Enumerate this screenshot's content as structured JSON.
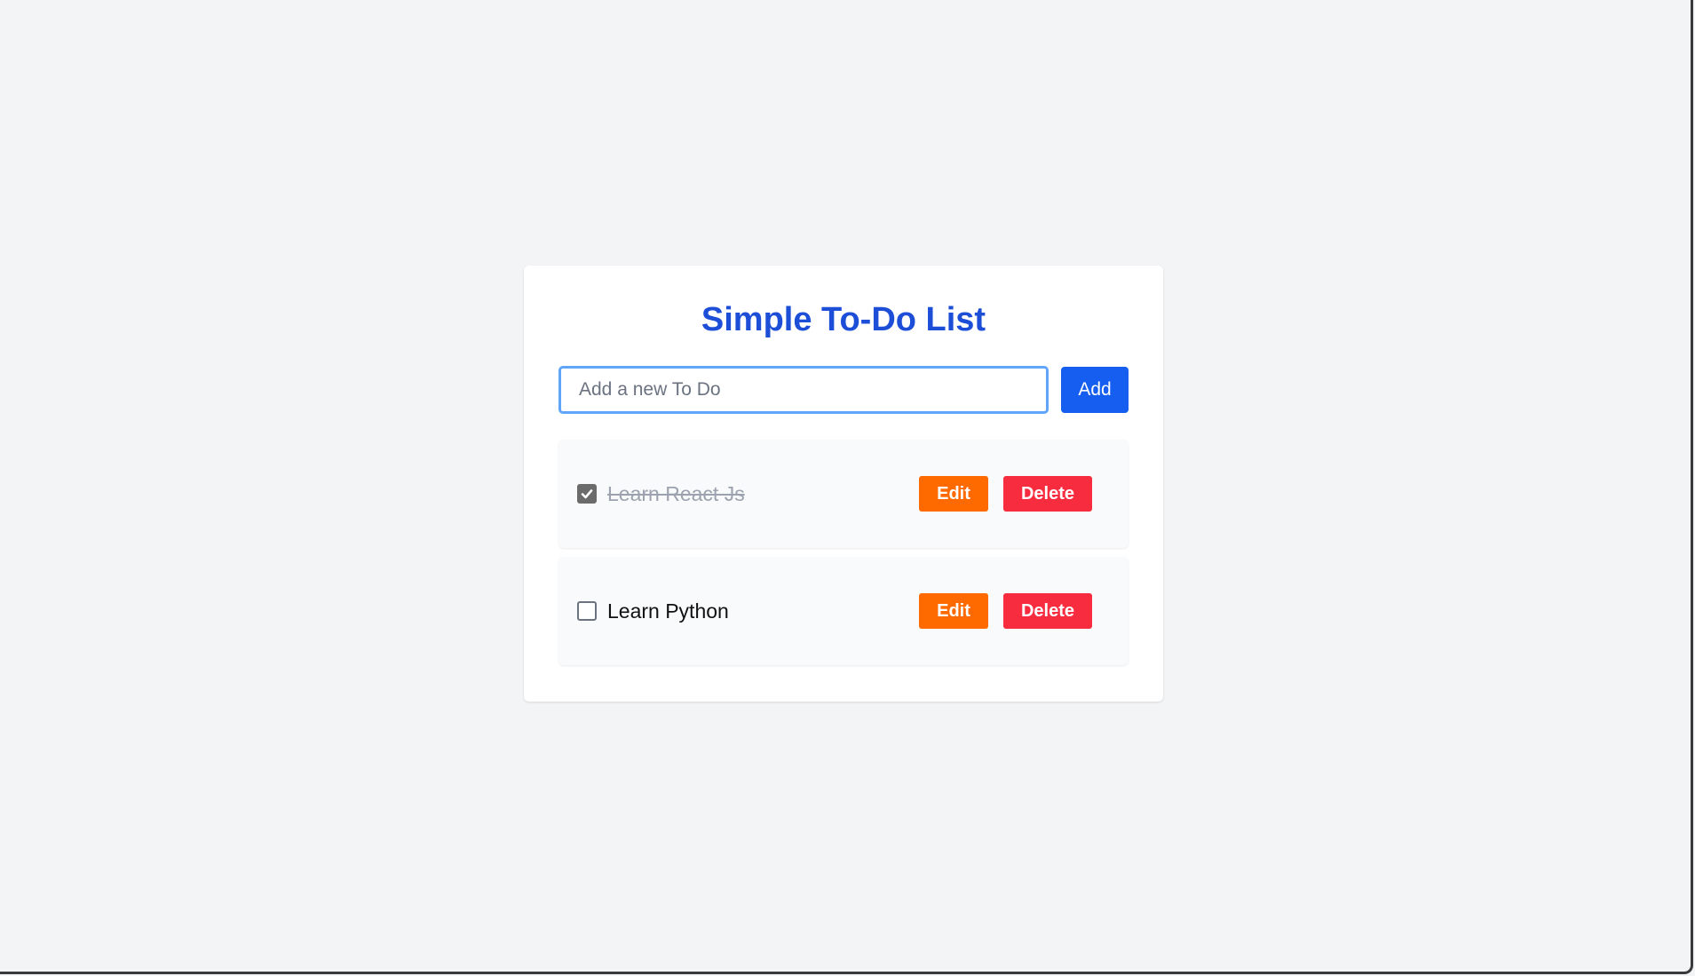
{
  "app": {
    "title": "Simple To-Do List"
  },
  "add_form": {
    "input_value": "",
    "placeholder": "Add a new To Do",
    "add_label": "Add"
  },
  "todos": [
    {
      "text": "Learn React Js",
      "completed": true,
      "edit_label": "Edit",
      "delete_label": "Delete"
    },
    {
      "text": "Learn Python",
      "completed": false,
      "edit_label": "Edit",
      "delete_label": "Delete"
    }
  ],
  "colors": {
    "page_background": "#f3f4f6",
    "title": "#1d4ed8",
    "add_button": "#155eef",
    "edit_button": "#ff6a00",
    "delete_button": "#f72c3e",
    "input_focus_border": "#60a5fa"
  },
  "icons": {
    "checked": "checkmark-icon"
  }
}
